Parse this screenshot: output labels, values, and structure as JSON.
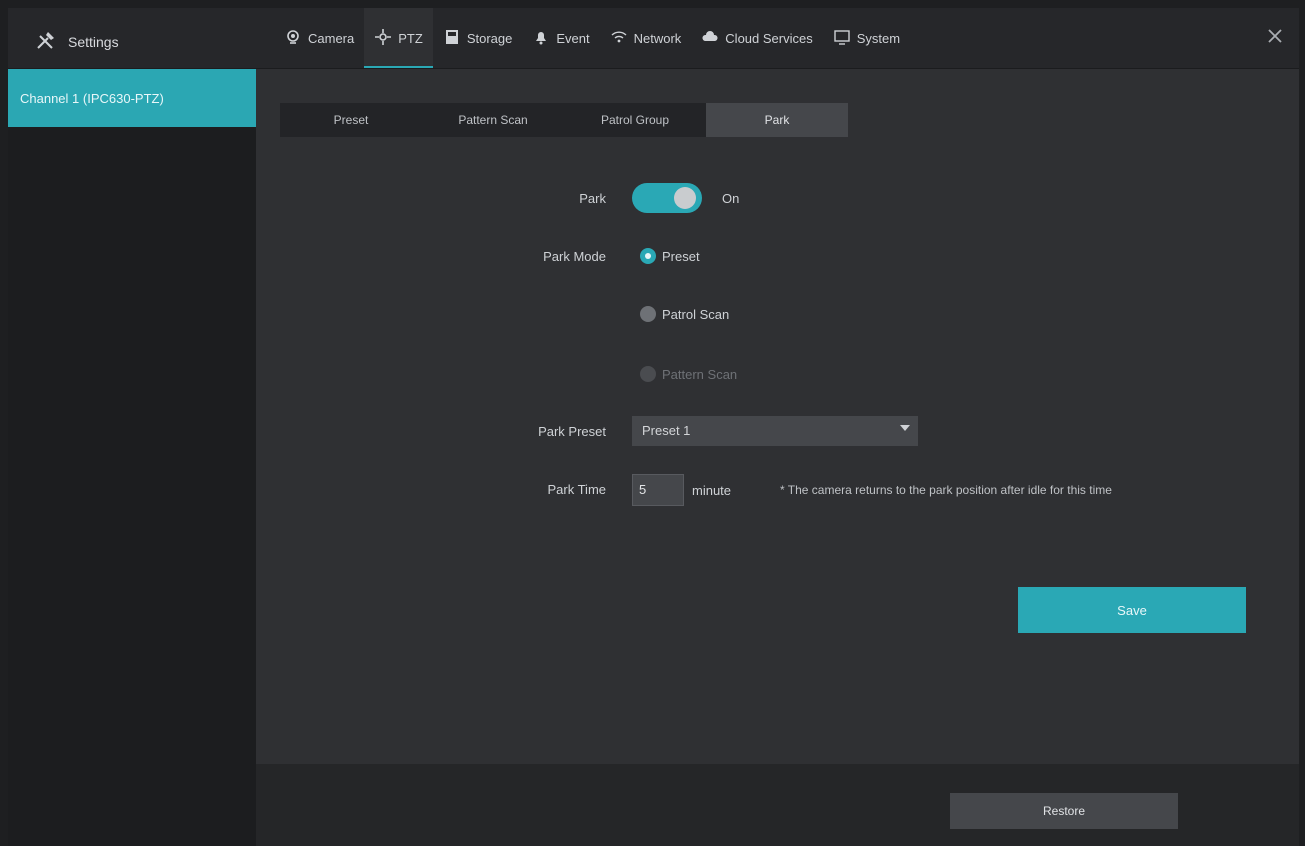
{
  "topbar": {
    "brand": "Settings",
    "nav": [
      {
        "label": "Camera",
        "icon": "camera-icon",
        "active": false
      },
      {
        "label": "PTZ",
        "icon": "ptz-icon",
        "active": true
      },
      {
        "label": "Storage",
        "icon": "storage-icon",
        "active": false
      },
      {
        "label": "Event",
        "icon": "bell-icon",
        "active": false
      },
      {
        "label": "Network",
        "icon": "network-icon",
        "active": false
      },
      {
        "label": "Cloud Services",
        "icon": "cloud-icon",
        "active": false
      },
      {
        "label": "System",
        "icon": "system-icon",
        "active": false
      }
    ],
    "close_icon": "close-icon"
  },
  "sidebar": {
    "items": [
      {
        "label": "Channel 1 (IPC630-PTZ)"
      }
    ]
  },
  "tabs": [
    {
      "label": "Preset",
      "active": false
    },
    {
      "label": "Pattern Scan",
      "active": false
    },
    {
      "label": "Patrol Group",
      "active": false
    },
    {
      "label": "Park",
      "active": true
    }
  ],
  "form": {
    "park_label": "Park",
    "park_state": "On",
    "park_mode_label": "Park Mode",
    "options": [
      {
        "label": "Preset",
        "state": "checked"
      },
      {
        "label": "Patrol Scan",
        "state": "unchecked"
      },
      {
        "label": "Pattern Scan",
        "state": "disabled"
      }
    ],
    "park_preset_label": "Park Preset",
    "park_preset_value": "Preset 1",
    "park_time_label": "Park Time",
    "park_time_value": "5",
    "park_time_unit": "minute",
    "hint": "* The camera returns to the park position after idle for this time"
  },
  "buttons": {
    "save": "Save",
    "footer": "Restore"
  },
  "colors": {
    "accent": "#2aa8b5",
    "background": "#2f3033"
  }
}
